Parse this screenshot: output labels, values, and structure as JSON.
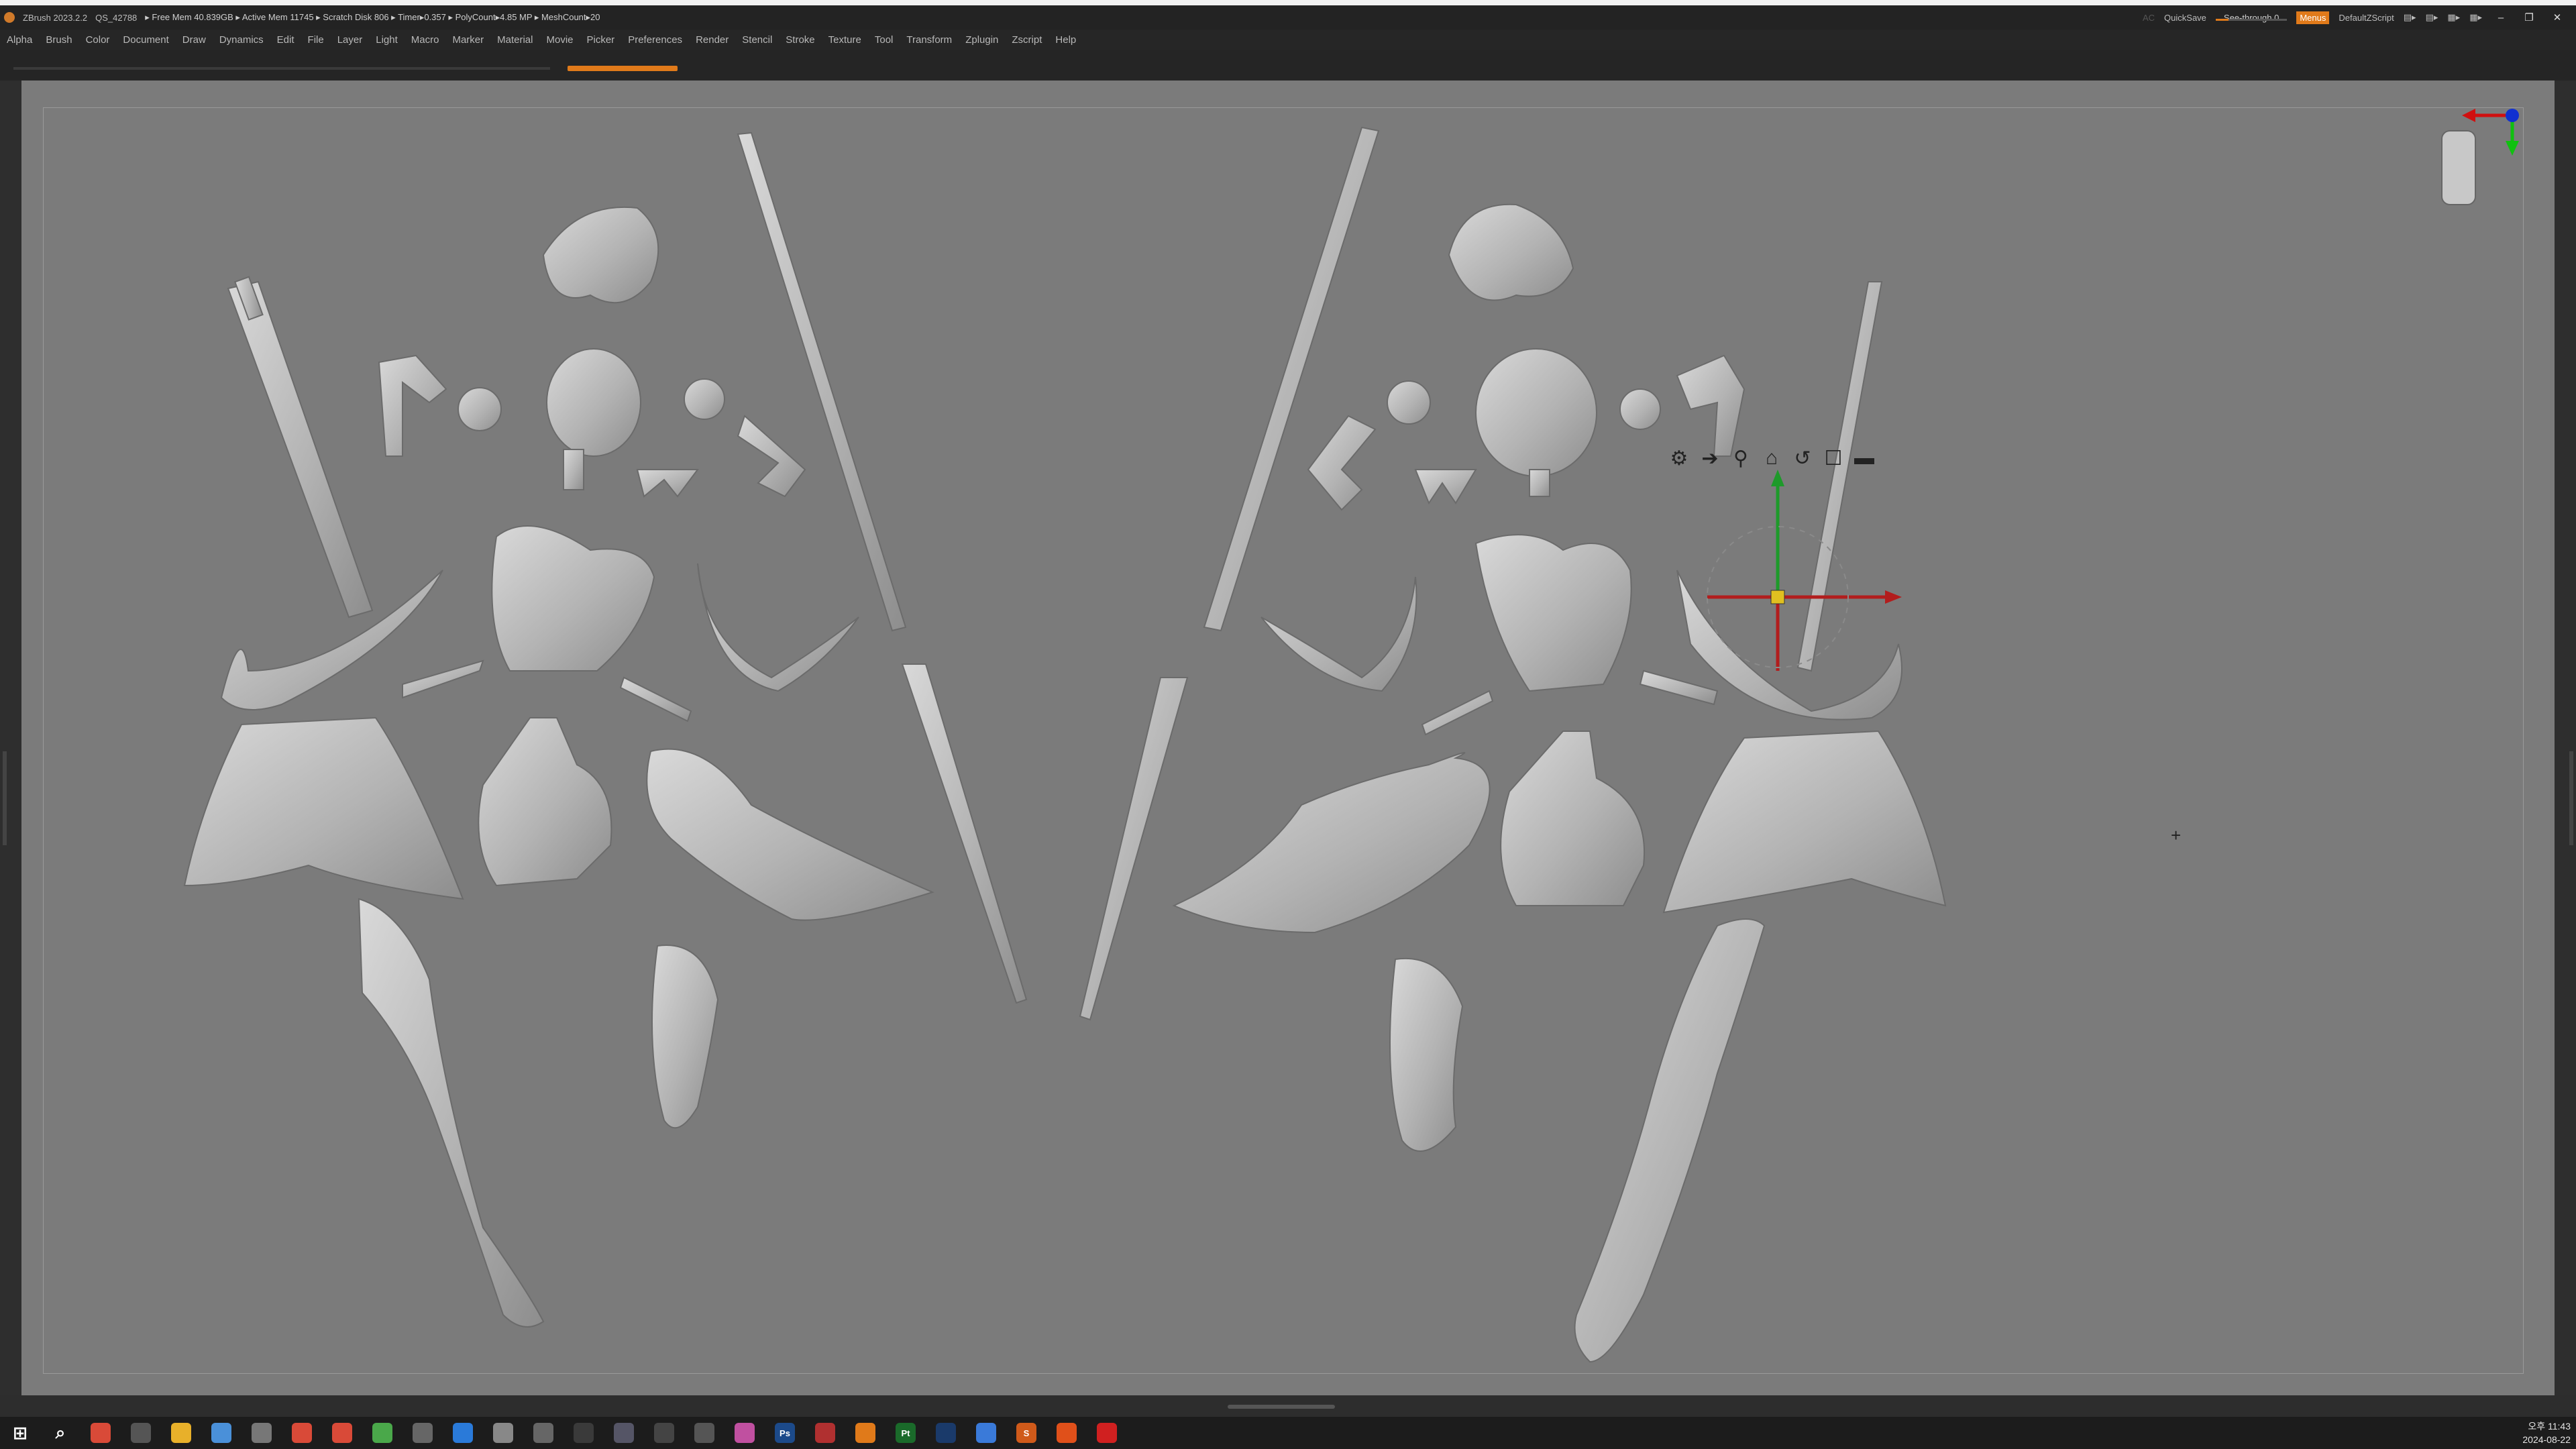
{
  "titlebar": {
    "app": "ZBrush 2023.2.2",
    "doc": "QS_42788",
    "stats": "▸ Free Mem 40.839GB ▸ Active Mem 11745 ▸ Scratch Disk 806 ▸ Timer▸0.357 ▸ PolyCount▸4.85 MP ▸ MeshCount▸20",
    "ac": "AC",
    "quicksave": "QuickSave",
    "see_through_label": "See-through",
    "see_through_value": "0",
    "menus": "Menus",
    "script": "DefaultZScript"
  },
  "menubar": [
    "Alpha",
    "Brush",
    "Color",
    "Document",
    "Draw",
    "Dynamics",
    "Edit",
    "File",
    "Layer",
    "Light",
    "Macro",
    "Marker",
    "Material",
    "Movie",
    "Picker",
    "Preferences",
    "Render",
    "Stencil",
    "Stroke",
    "Texture",
    "Tool",
    "Transform",
    "Zplugin",
    "Zscript",
    "Help"
  ],
  "window_buttons": {
    "minimize": "–",
    "restore": "❐",
    "close": "✕"
  },
  "taskbar": {
    "apps": [
      "start-icon",
      "search-icon",
      "chrome-icon",
      "magnifier-icon",
      "file-explorer-icon",
      "notes-icon",
      "unity-icon",
      "chrome-icon",
      "chrome-icon",
      "chrome-icon",
      "unity-hub-icon",
      "maps-icon",
      "archive-icon",
      "pen-icon",
      "u-icon",
      "tool-icon",
      "zbrush-icon",
      "zbrush-icon",
      "photos-icon",
      "photoshop-icon",
      "acrobat-icon",
      "blender-icon",
      "painter-icon",
      "steam-icon",
      "pin-icon",
      "substance-icon",
      "origin-icon",
      "red-icon"
    ],
    "ps_label": "Ps",
    "pt_label": "Pt",
    "s_label": "S",
    "time": "오후 11:43",
    "date": "2024-08-22"
  },
  "accent_color": "#e07a1a",
  "canvas_color": "#7b7b7b"
}
